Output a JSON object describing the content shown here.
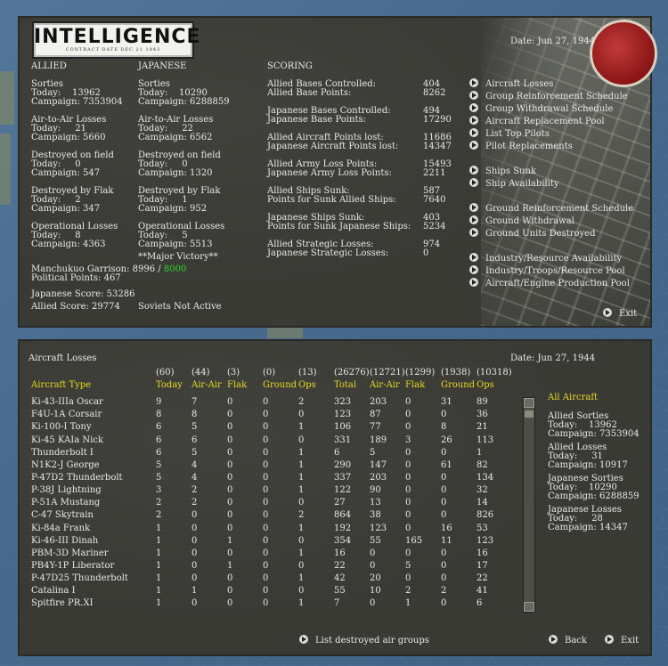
{
  "logo": {
    "title": "INTELLIGENCE",
    "subtitle": "CONTRACT DATE DEC 21 1943"
  },
  "top": {
    "date": "Date: Jun 27, 1944",
    "allied": {
      "header": "ALLIED",
      "sorties": "Sorties",
      "sorties_today": "Today:    13962",
      "sorties_campaign": "Campaign: 7353904",
      "a2a": "Air-to-Air Losses",
      "a2a_today": "Today:     21",
      "a2a_campaign": "Campaign: 5660",
      "field": "Destroyed on field",
      "field_today": "Today:     0",
      "field_campaign": "Campaign: 547",
      "flak": "Destroyed by Flak",
      "flak_today": "Today:     2",
      "flak_campaign": "Campaign: 347",
      "ops": "Operational Losses",
      "ops_today": "Today:     8",
      "ops_campaign": "Campaign: 4363"
    },
    "japanese": {
      "header": "JAPANESE",
      "sorties": "Sorties",
      "sorties_today": "Today:    10290",
      "sorties_campaign": "Campaign: 6288859",
      "a2a": "Air-to-Air Losses",
      "a2a_today": "Today:     22",
      "a2a_campaign": "Campaign: 6562",
      "field": "Destroyed on field",
      "field_today": "Today:     0",
      "field_campaign": "Campaign: 1320",
      "flak": "Destroyed by Flak",
      "flak_today": "Today:     1",
      "flak_campaign": "Campaign: 952",
      "ops": "Operational Losses",
      "ops_today": "Today:     5",
      "ops_campaign": "Campaign: 5513",
      "victory": "**Major Victory**"
    },
    "manchukuo_label": "Manchukuo Garrison: 8996 /",
    "manchukuo_req": "8000",
    "political": "Political Points: 467",
    "japanese_score": "Japanese Score: 53286",
    "allied_score": "Allied Score: 29774",
    "soviets": "Soviets Not Active",
    "scoring": {
      "header": "SCORING",
      "rows": [
        {
          "label": "Allied Bases Controlled:",
          "value": "404"
        },
        {
          "label": "Allied Base Points:",
          "value": "8262"
        },
        {
          "label": "Japanese Bases Controlled:",
          "value": "494"
        },
        {
          "label": "Japanese Base Points:",
          "value": "17290"
        },
        {
          "label": "Allied Aircraft Points lost:",
          "value": "11686"
        },
        {
          "label": "Japanese Aircraft Points lost:",
          "value": "14347"
        },
        {
          "label": "Allied Army Loss Points:",
          "value": "15493"
        },
        {
          "label": "Japanese Army Loss Points:",
          "value": "2211"
        },
        {
          "label": "Allied Ships Sunk:",
          "value": "587"
        },
        {
          "label": "Points for Sunk Allied Ships:",
          "value": "7640"
        },
        {
          "label": "Japanese Ships Sunk:",
          "value": "403"
        },
        {
          "label": "Points for Sunk Japanese Ships:",
          "value": "5234"
        },
        {
          "label": "Allied Strategic Losses:",
          "value": "974"
        },
        {
          "label": "Japanese Strategic Losses:",
          "value": "0"
        }
      ]
    },
    "links": [
      "Aircraft Losses",
      "Group Reinforcement Schedule",
      "Group Withdrawal Schedule",
      "Aircraft Replacement Pool",
      "List Top Pilots",
      "Pilot Replacements",
      "Ships Sunk",
      "Ship Availability",
      "Ground Reinforcement Schedule",
      "Ground Withdrawal",
      "Ground Units Destroyed",
      "Industry/Resource Availability",
      "Industry/Troops/Resource Pool",
      "Aircraft/Engine Production Pool"
    ],
    "exit": "Exit"
  },
  "bottom": {
    "title": "Aircraft Losses",
    "date": "Date: Jun 27, 1944",
    "totals": [
      "(60)",
      "(44)",
      "(3)",
      "(0)",
      "(13)",
      "(26276)",
      "(12721)",
      "(1299)",
      "(1938)",
      "(10318)"
    ],
    "headers": [
      "Aircraft Type",
      "Today",
      "Air-Air",
      "Flak",
      "Ground",
      "Ops",
      "Total",
      "Air-Air",
      "Flak",
      "Ground",
      "Ops"
    ],
    "rows": [
      [
        "Ki-43-IIIa Oscar",
        "9",
        "7",
        "0",
        "0",
        "2",
        "323",
        "203",
        "0",
        "31",
        "89"
      ],
      [
        "F4U-1A Corsair",
        "8",
        "8",
        "0",
        "0",
        "0",
        "123",
        "87",
        "0",
        "0",
        "36"
      ],
      [
        "Ki-100-I Tony",
        "6",
        "5",
        "0",
        "0",
        "1",
        "106",
        "77",
        "0",
        "8",
        "21"
      ],
      [
        "Ki-45 KAIa Nick",
        "6",
        "6",
        "0",
        "0",
        "0",
        "331",
        "189",
        "3",
        "26",
        "113"
      ],
      [
        "Thunderbolt I",
        "6",
        "5",
        "0",
        "0",
        "1",
        "6",
        "5",
        "0",
        "0",
        "1"
      ],
      [
        "N1K2-J George",
        "5",
        "4",
        "0",
        "0",
        "1",
        "290",
        "147",
        "0",
        "61",
        "82"
      ],
      [
        "P-47D2 Thunderbolt",
        "5",
        "4",
        "0",
        "0",
        "1",
        "337",
        "203",
        "0",
        "0",
        "134"
      ],
      [
        "P-38J Lightning",
        "3",
        "2",
        "0",
        "0",
        "1",
        "122",
        "90",
        "0",
        "0",
        "32"
      ],
      [
        "P-51A Mustang",
        "2",
        "2",
        "0",
        "0",
        "0",
        "27",
        "13",
        "0",
        "0",
        "14"
      ],
      [
        "C-47 Skytrain",
        "2",
        "0",
        "0",
        "0",
        "2",
        "864",
        "38",
        "0",
        "0",
        "826"
      ],
      [
        "Ki-84a Frank",
        "1",
        "0",
        "0",
        "0",
        "1",
        "192",
        "123",
        "0",
        "16",
        "53"
      ],
      [
        "Ki-46-III Dinah",
        "1",
        "0",
        "1",
        "0",
        "0",
        "354",
        "55",
        "165",
        "11",
        "123"
      ],
      [
        "PBM-3D Mariner",
        "1",
        "0",
        "0",
        "0",
        "1",
        "16",
        "0",
        "0",
        "0",
        "16"
      ],
      [
        "PB4Y-1P Liberator",
        "1",
        "0",
        "1",
        "0",
        "0",
        "22",
        "0",
        "5",
        "0",
        "17"
      ],
      [
        "P-47D25 Thunderbolt",
        "1",
        "0",
        "0",
        "0",
        "1",
        "42",
        "20",
        "0",
        "0",
        "22"
      ],
      [
        "Catalina I",
        "1",
        "1",
        "0",
        "0",
        "0",
        "55",
        "10",
        "2",
        "2",
        "41"
      ],
      [
        "Spitfire PR.XI",
        "1",
        "0",
        "0",
        "0",
        "1",
        "7",
        "0",
        "1",
        "0",
        "6"
      ]
    ],
    "summary": {
      "title": "All Aircraft",
      "allied_sorties": "Allied Sorties",
      "allied_sorties_today": "Today:    13962",
      "allied_sorties_campaign": "Campaign: 7353904",
      "allied_losses": "Allied Losses",
      "allied_losses_today": "Today:     31",
      "allied_losses_campaign": "Campaign: 10917",
      "jap_sorties": "Japanese Sorties",
      "jap_sorties_today": "Today:    10290",
      "jap_sorties_campaign": "Campaign: 6288859",
      "jap_losses": "Japanese Losses",
      "jap_losses_today": "Today:     28",
      "jap_losses_campaign": "Campaign: 14347"
    },
    "list_groups": "List destroyed air groups",
    "back": "Back",
    "exit": "Exit"
  }
}
